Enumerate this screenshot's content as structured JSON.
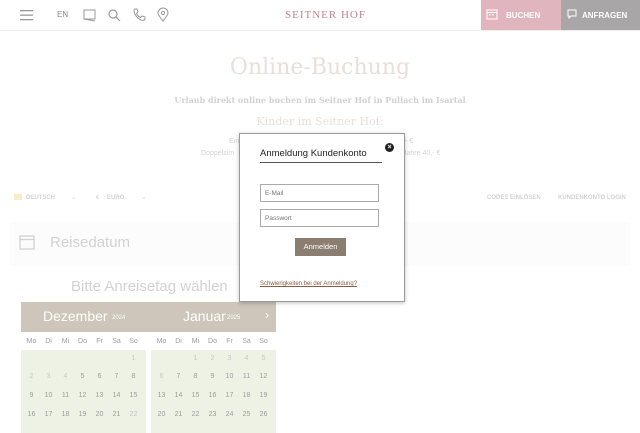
{
  "header": {
    "language": "EN",
    "logo": "Seitner Hof",
    "buchen_label": "BUCHEN",
    "anfragen_label": "ANFRAGEN"
  },
  "page": {
    "title": "Online-Buchung",
    "subtitle": "Urlaub direkt online buchen im Seitner Hof in Pullach im Isartal",
    "kids_heading": "Kinder im Seitner Hof:",
    "kids_line1_start": "Ein",
    "kids_line1_end": "- €",
    "kids_line2_start": "Doppelzim",
    "kids_line2_end": "Jahre 40,- €"
  },
  "toolbar": {
    "language_select": "DEUTSCH",
    "currency_select": "EURO",
    "codes_label": "CODES EINLÖSEN",
    "login_label": "KUNDENKONTO LOGIN"
  },
  "reise": {
    "label": "Reisedatum",
    "prompt": "Bitte Anreisetag wählen"
  },
  "calendar": {
    "month1": "Dezember",
    "year1": "2024",
    "month2": "Januar",
    "year2": "2025",
    "weekdays": [
      "Mo",
      "Di",
      "Mi",
      "Do",
      "Fr",
      "Sa",
      "So"
    ],
    "dec_row2": [
      "2",
      "3",
      "4",
      "5",
      "6",
      "7",
      "8"
    ],
    "dec_row3": [
      "9",
      "10",
      "11",
      "12",
      "13",
      "14",
      "15"
    ],
    "dec_row4": [
      "16",
      "17",
      "18",
      "19",
      "20",
      "21",
      "22"
    ],
    "jan_row1": [
      "1",
      "2",
      "3",
      "4",
      "5"
    ],
    "jan_row2": [
      "6",
      "7",
      "8",
      "9",
      "10",
      "11",
      "12"
    ],
    "jan_row3": [
      "13",
      "14",
      "15",
      "16",
      "17",
      "18",
      "19"
    ],
    "jan_row4": [
      "20",
      "21",
      "22",
      "23",
      "24",
      "25",
      "26"
    ],
    "dec_first": "1"
  },
  "modal": {
    "title": "Anmeldung Kundenkonto",
    "email_placeholder": "E-Mail",
    "password_placeholder": "Passwort",
    "login_button": "Anmelden",
    "trouble_link": "Schwierigkeiten bei der Anmeldung?"
  }
}
